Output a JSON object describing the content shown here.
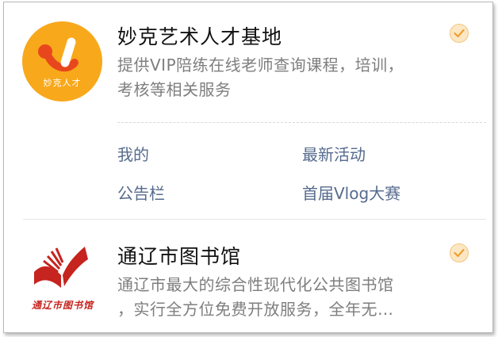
{
  "cards": [
    {
      "title": "妙克艺术人才基地",
      "logo_text": "妙克人才",
      "description_lines": [
        "提供VIP陪练在线老师查询课程，培训，",
        "考核等相关服务"
      ],
      "verified_icon": "check-badge-icon",
      "links": [
        "我的",
        "最新活动",
        "公告栏",
        "首届Vlog大赛"
      ]
    },
    {
      "title": "通辽市图书馆",
      "logo_text": "通辽市图书馆",
      "description_lines": [
        "通辽市最大的综合性现代化公共图书馆",
        "，实行全方位免费开放服务，全年无…"
      ],
      "verified_icon": "check-badge-icon"
    }
  ],
  "colors": {
    "logo_orange": "#f8a81b",
    "link_blue": "#556b8d",
    "library_red": "#c5241f",
    "badge_orange": "#f0a030"
  }
}
